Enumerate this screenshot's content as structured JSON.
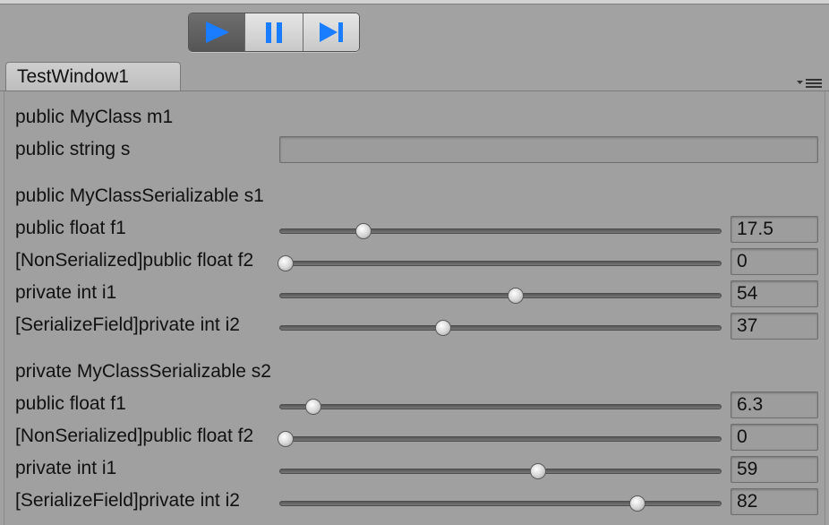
{
  "toolbar": {
    "play": {
      "icon": "play-icon",
      "active": true,
      "color": "#1a7cff"
    },
    "pause": {
      "icon": "pause-icon",
      "color": "#1a7cff"
    },
    "step": {
      "icon": "step-icon",
      "color": "#1a7cff"
    }
  },
  "window": {
    "tab_title": "TestWindow1",
    "menu_icon": "menu-icon"
  },
  "fields": {
    "m1_label": "public MyClass m1",
    "s_label": "public string s",
    "s_value": "",
    "s1_header": "public MyClassSerializable s1",
    "s2_header": "private MyClassSerializable s2"
  },
  "sliders_s1": [
    {
      "label": "public float f1",
      "value": "17.5",
      "fraction": 0.19
    },
    {
      "label": "[NonSerialized]public float f2",
      "value": "0",
      "fraction": 0.015
    },
    {
      "label": "private int i1",
      "value": "54",
      "fraction": 0.535
    },
    {
      "label": "[SerializeField]private int i2",
      "value": "37",
      "fraction": 0.37
    }
  ],
  "sliders_s2": [
    {
      "label": "public float f1",
      "value": "6.3",
      "fraction": 0.076
    },
    {
      "label": "[NonSerialized]public float f2",
      "value": "0",
      "fraction": 0.015
    },
    {
      "label": "private int i1",
      "value": "59",
      "fraction": 0.585
    },
    {
      "label": "[SerializeField]private int i2",
      "value": "82",
      "fraction": 0.81
    }
  ]
}
